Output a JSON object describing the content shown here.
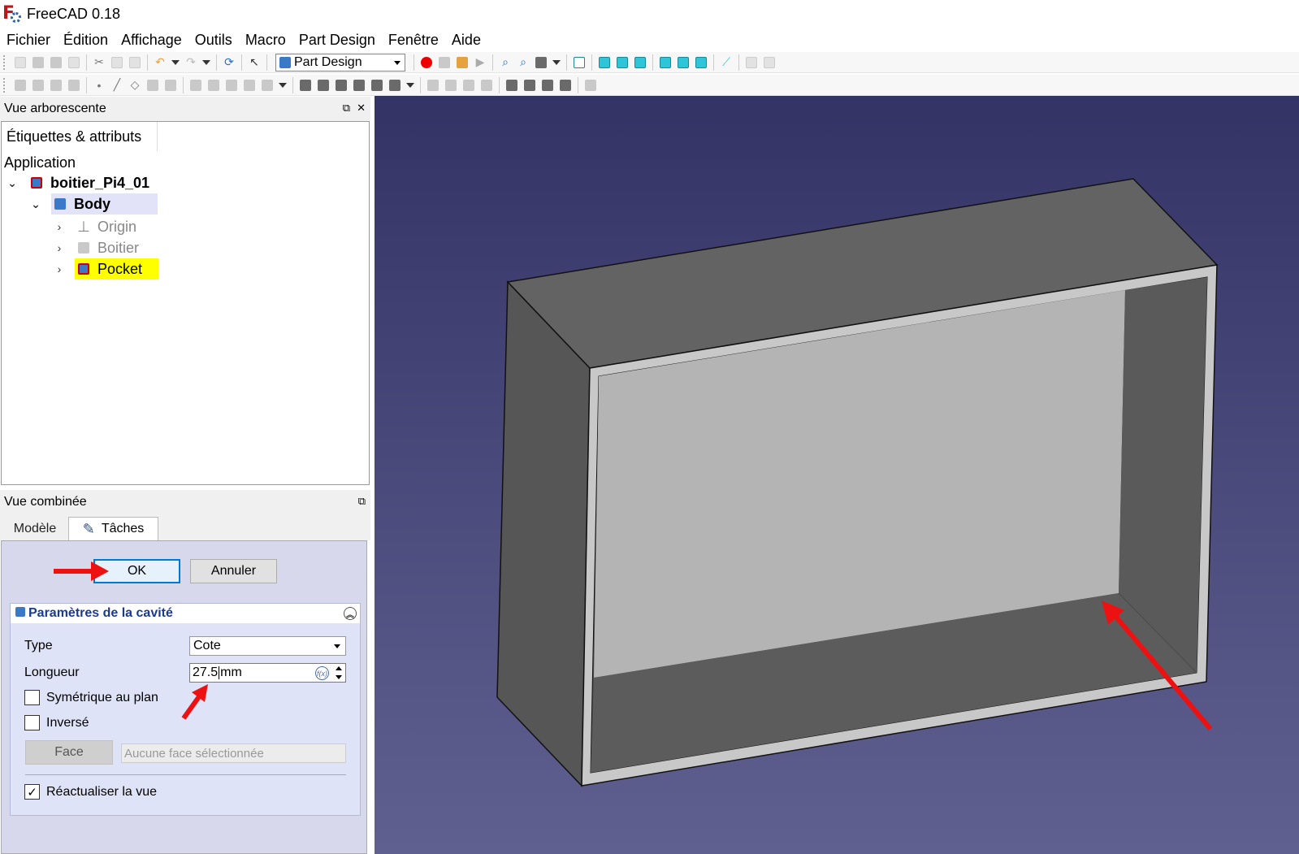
{
  "window": {
    "title": "FreeCAD 0.18"
  },
  "menu": [
    "Fichier",
    "Édition",
    "Affichage",
    "Outils",
    "Macro",
    "Part Design",
    "Fenêtre",
    "Aide"
  ],
  "toolbar": {
    "workbench": "Part Design"
  },
  "tree_view": {
    "title": "Vue arborescente",
    "tab": "Étiquettes & attributs",
    "root": "Application",
    "document": "boitier_Pi4_01",
    "body": "Body",
    "children": [
      "Origin",
      "Boitier",
      "Pocket"
    ]
  },
  "combo_view": {
    "title": "Vue combinée",
    "tabs": {
      "model": "Modèle",
      "tasks": "Tâches"
    },
    "ok_label": "OK",
    "cancel_label": "Annuler",
    "group_title": "Paramètres de la cavité",
    "type_label": "Type",
    "type_value": "Cote",
    "length_label": "Longueur",
    "length_value": "27.5",
    "length_unit": "mm",
    "symmetric_label": "Symétrique au plan",
    "symmetric_checked": false,
    "reversed_label": "Inversé",
    "reversed_checked": false,
    "face_button": "Face",
    "face_placeholder": "Aucune face sélectionnée",
    "refresh_label": "Réactualiser la vue",
    "refresh_checked": true
  },
  "colors": {
    "viewport_top": "#333366",
    "viewport_bottom": "#606090",
    "highlight": "#ffff00",
    "annotation_arrow": "#ee1111"
  }
}
